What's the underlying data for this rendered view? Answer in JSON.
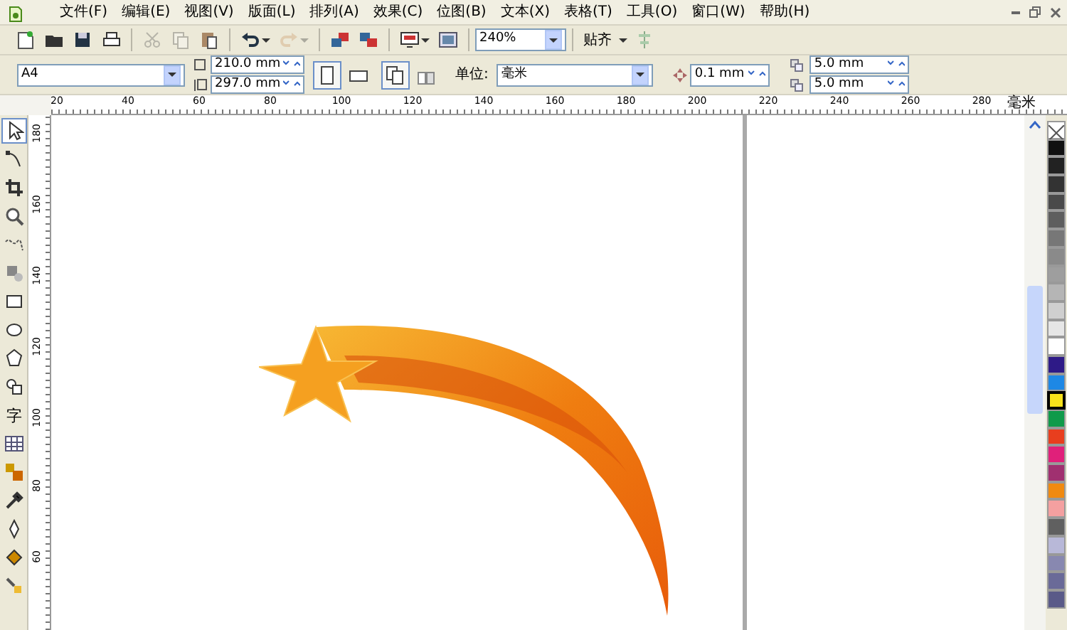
{
  "menu": [
    "文件(F)",
    "编辑(E)",
    "视图(V)",
    "版面(L)",
    "排列(A)",
    "效果(C)",
    "位图(B)",
    "文本(X)",
    "表格(T)",
    "工具(O)",
    "窗口(W)",
    "帮助(H)"
  ],
  "toolbar": {
    "groups": [
      [
        {
          "kind": "new",
          "disabled": false,
          "dropdown": false
        },
        {
          "kind": "open",
          "disabled": false,
          "dropdown": false
        },
        {
          "kind": "save",
          "disabled": false,
          "dropdown": false
        },
        {
          "kind": "print",
          "disabled": false,
          "dropdown": false
        }
      ],
      [
        {
          "kind": "cut",
          "disabled": true,
          "dropdown": false
        },
        {
          "kind": "copy",
          "disabled": true,
          "dropdown": false
        },
        {
          "kind": "paste",
          "disabled": false,
          "dropdown": false
        }
      ],
      [
        {
          "kind": "undo",
          "disabled": false,
          "dropdown": true
        },
        {
          "kind": "redo",
          "disabled": true,
          "dropdown": true
        }
      ],
      [
        {
          "kind": "import",
          "disabled": false,
          "dropdown": false
        },
        {
          "kind": "export",
          "disabled": false,
          "dropdown": false
        }
      ],
      [
        {
          "kind": "launcher",
          "disabled": false,
          "dropdown": true
        },
        {
          "kind": "welcome",
          "disabled": false,
          "dropdown": false
        }
      ]
    ],
    "zoom": "240%",
    "snap": "贴齐"
  },
  "property_bar": {
    "paper": "A4",
    "width": "210.0 mm",
    "height": "297.0 mm",
    "orientation": [
      {
        "kind": "portrait",
        "selected": true
      },
      {
        "kind": "landscape",
        "selected": false
      }
    ],
    "page_scope": [
      {
        "kind": "all_pages",
        "selected": true
      },
      {
        "kind": "current_page",
        "selected": false
      }
    ],
    "units_label": "单位:",
    "units": "毫米",
    "nudge": "0.1 mm",
    "duplicate_x": "5.0 mm",
    "duplicate_y": "5.0 mm"
  },
  "rulers": {
    "horizontal": [
      "20",
      "40",
      "60",
      "80",
      "100",
      "120",
      "140",
      "160",
      "180",
      "200",
      "220",
      "240",
      "260",
      "280"
    ],
    "unit": "毫米",
    "vertical": [
      "180",
      "160",
      "140",
      "120",
      "100",
      "80",
      "60"
    ]
  },
  "toolbox": [
    {
      "kind": "pick",
      "selected": true
    },
    {
      "kind": "shape",
      "selected": false
    },
    {
      "kind": "crop",
      "selected": false
    },
    {
      "kind": "zoom",
      "selected": false
    },
    {
      "kind": "freehand",
      "selected": false
    },
    {
      "kind": "smartfill",
      "selected": false
    },
    {
      "kind": "rectangle",
      "selected": false
    },
    {
      "kind": "ellipse",
      "selected": false
    },
    {
      "kind": "polygon",
      "selected": false
    },
    {
      "kind": "shapes",
      "selected": false
    },
    {
      "kind": "text",
      "selected": false,
      "label": "字"
    },
    {
      "kind": "table",
      "selected": false
    },
    {
      "kind": "blend",
      "selected": false
    },
    {
      "kind": "eyedropper",
      "selected": false
    },
    {
      "kind": "outline",
      "selected": false
    },
    {
      "kind": "fill",
      "selected": false
    },
    {
      "kind": "interactive_fill",
      "selected": false
    }
  ],
  "palette": [
    {
      "kind": "none",
      "selected": false
    },
    {
      "color": "#111111",
      "selected": false
    },
    {
      "color": "#222222",
      "selected": false
    },
    {
      "color": "#333333",
      "selected": false
    },
    {
      "color": "#4a4a4a",
      "selected": false
    },
    {
      "color": "#5e5e5e",
      "selected": false
    },
    {
      "color": "#777777",
      "selected": false
    },
    {
      "color": "#8a8a8a",
      "selected": false
    },
    {
      "color": "#9e9e9e",
      "selected": false
    },
    {
      "color": "#b5b5b5",
      "selected": false
    },
    {
      "color": "#cfcfcf",
      "selected": false
    },
    {
      "color": "#e6e6e6",
      "selected": false
    },
    {
      "color": "#ffffff",
      "selected": false
    },
    {
      "color": "#2e1a87",
      "selected": false
    },
    {
      "color": "#1e88e5",
      "selected": false
    },
    {
      "color": "#f7e11a",
      "selected": true
    },
    {
      "color": "#0f9a4a",
      "selected": false
    },
    {
      "color": "#e83e1e",
      "selected": false
    },
    {
      "color": "#e0207a",
      "selected": false
    },
    {
      "color": "#a03070",
      "selected": false
    },
    {
      "color": "#f08a10",
      "selected": false
    },
    {
      "color": "#f4a0a0",
      "selected": false
    },
    {
      "color": "#606060",
      "selected": false
    },
    {
      "color": "#b8b8d8",
      "selected": false
    },
    {
      "color": "#8888b0",
      "selected": false
    },
    {
      "color": "#6a6a98",
      "selected": false
    },
    {
      "color": "#5a5a88",
      "selected": false
    }
  ]
}
